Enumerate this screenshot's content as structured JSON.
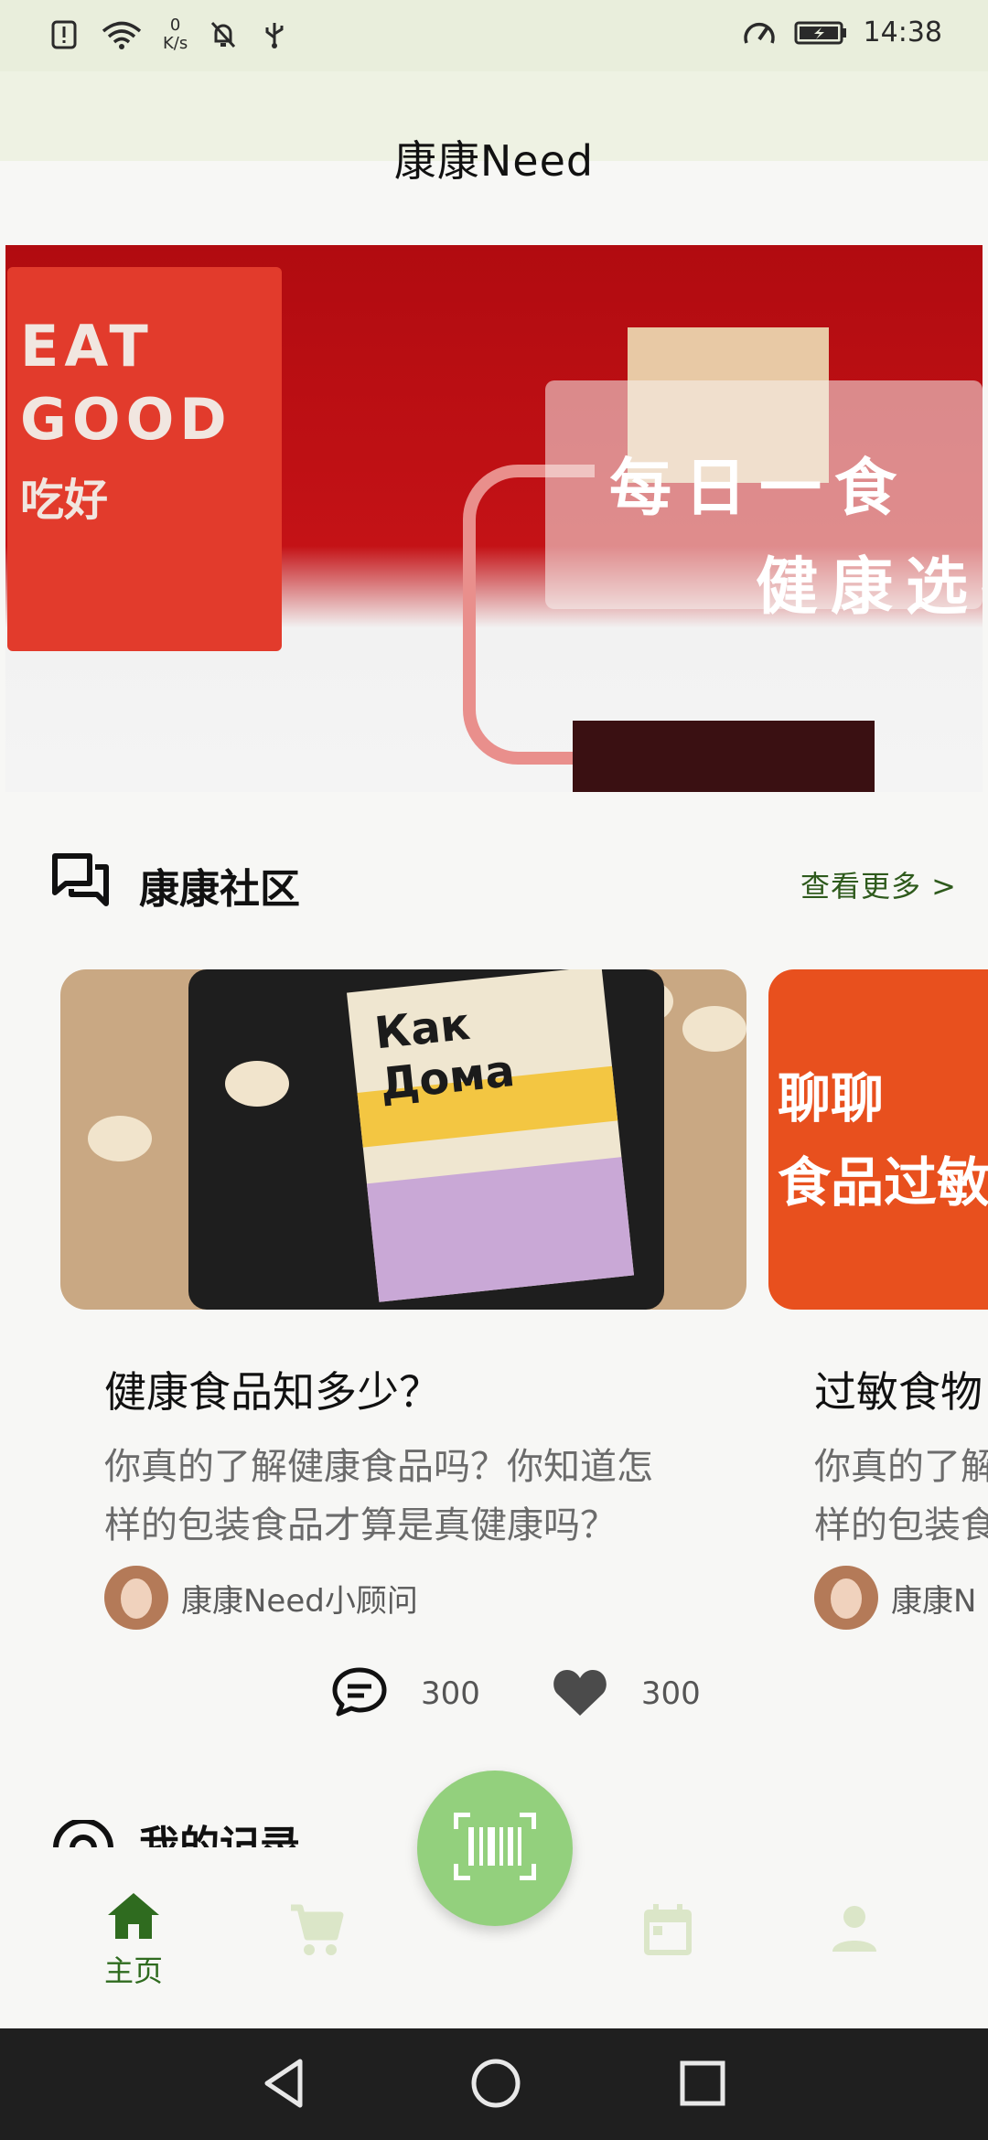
{
  "status_bar": {
    "net_speed_value": "0",
    "net_speed_unit": "K/s",
    "time": "14:38"
  },
  "app": {
    "title": "康康Need"
  },
  "banner": {
    "box_lines": [
      "EAT",
      "GOOD",
      "吃好"
    ],
    "headline_1": "每日一食",
    "headline_2": "健康选择"
  },
  "community": {
    "title": "康康社区",
    "view_more": "查看更多 >"
  },
  "cards": [
    {
      "image_brand": "Как Дома",
      "title": "健康食品知多少？",
      "desc_line1": "你真的了解健康食品吗？你知道怎",
      "desc_line2": "样的包装食品才算是真健康吗？",
      "author": "康康Need小顾问",
      "comments": "300",
      "likes": "300"
    },
    {
      "image_line1": "聊聊",
      "image_line2": "食品过敏",
      "title": "过敏食物",
      "desc_line1": "你真的了解",
      "desc_line2": "样的包装食",
      "author": "康康N"
    }
  ],
  "records": {
    "title": "我的记录"
  },
  "bottom_nav": {
    "home_label": "主页",
    "active": "home",
    "accent_color": "#2f6b1f",
    "inactive_color": "#dbe6c8"
  }
}
